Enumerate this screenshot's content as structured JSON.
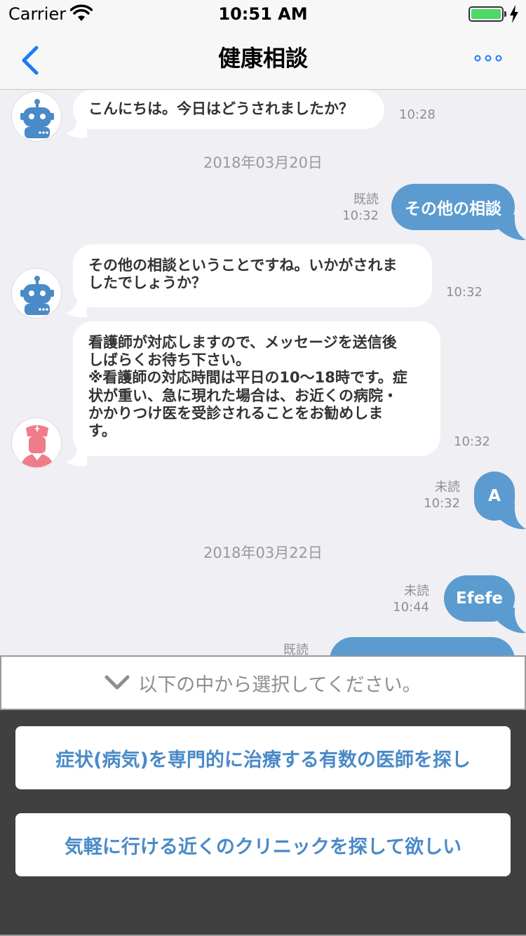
{
  "status_bar": {
    "carrier": "Carrier",
    "time": "10:51 AM"
  },
  "nav": {
    "title": "健康相談"
  },
  "messages": {
    "m1": {
      "text": "こんにちは。今日はどうされましたか？",
      "time": "10:28"
    },
    "date1": "2018年03月20日",
    "m2": {
      "text": "その他の相談",
      "status": "既読",
      "time": "10:32"
    },
    "m3": {
      "line1": "その他の相談ということですね。いかがされま",
      "line2": "したでしょうか？",
      "time": "10:32"
    },
    "m4": {
      "lines": [
        "看護師が対応しますので、メッセージを送信後",
        "しばらくお待ち下さい。",
        "※看護師の対応時間は平日の10〜18時です。症",
        "状が重い、急に現れた場合は、お近くの病院・",
        "かかりつけ医を受診されることをお勧めしま",
        "す。"
      ],
      "time": "10:32"
    },
    "m5": {
      "text": "A",
      "status": "未読",
      "time": "10:32"
    },
    "date2": "2018年03月22日",
    "m6": {
      "text": "Efefe",
      "status": "未読",
      "time": "10:44"
    },
    "m7": {
      "status": "既読"
    }
  },
  "selector": {
    "prompt": "以下の中から選択してください。"
  },
  "options": [
    {
      "label": "症状(病気)を専門的に治療する有数の医師を探し"
    },
    {
      "label": "気軽に行ける近くのクリニックを探して欲しい"
    }
  ],
  "colors": {
    "accent": "#5b9bd0",
    "link": "#4a8ac8",
    "panel": "#404040",
    "battery": "#4cd964"
  }
}
